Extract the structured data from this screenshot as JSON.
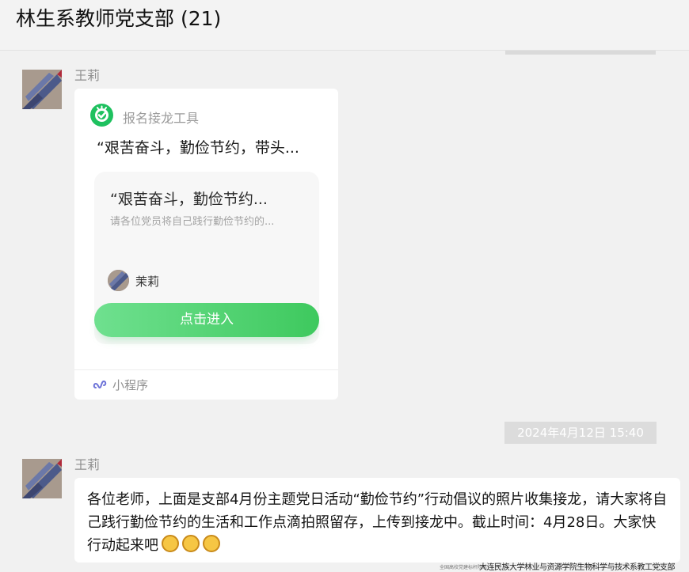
{
  "header": {
    "title": "林生系教师党支部 (21)"
  },
  "messages": [
    {
      "sender": "王莉",
      "card": {
        "tool_name": "报名接龙工具",
        "title": "“艰苦奋斗，勤俭节约，带头...",
        "inner_title": "“艰苦奋斗，勤俭节约...",
        "inner_subtitle": "请各位党员将自己践行勤俭节约的...",
        "creator_name": "茉莉",
        "button_label": "点击进入",
        "footer_label": "小程序",
        "footer_icon": "mini-program-icon"
      }
    },
    {
      "timestamp": "2024年4月12日 15:40",
      "sender": "王莉",
      "text": "各位老师，上面是支部4月份主题党日活动“勤俭节约”行动倡议的照片收集接龙，请大家将自己践行勤俭节约的生活和工作点滴拍照留存，上传到接龙中。截止时间：4月28日。大家快行动起来吧",
      "emoji": [
        "fist-emoji",
        "fist-emoji",
        "fist-emoji"
      ]
    }
  ],
  "footer": {
    "watermark_small": "全国高校党建标杆院系",
    "watermark": "大连民族大学林业与资源学院生物科学与技术系教工党支部"
  },
  "colors": {
    "accent_green": "#1ec15f",
    "button_green": "#3ec95e",
    "background": "#f1f1f1"
  }
}
